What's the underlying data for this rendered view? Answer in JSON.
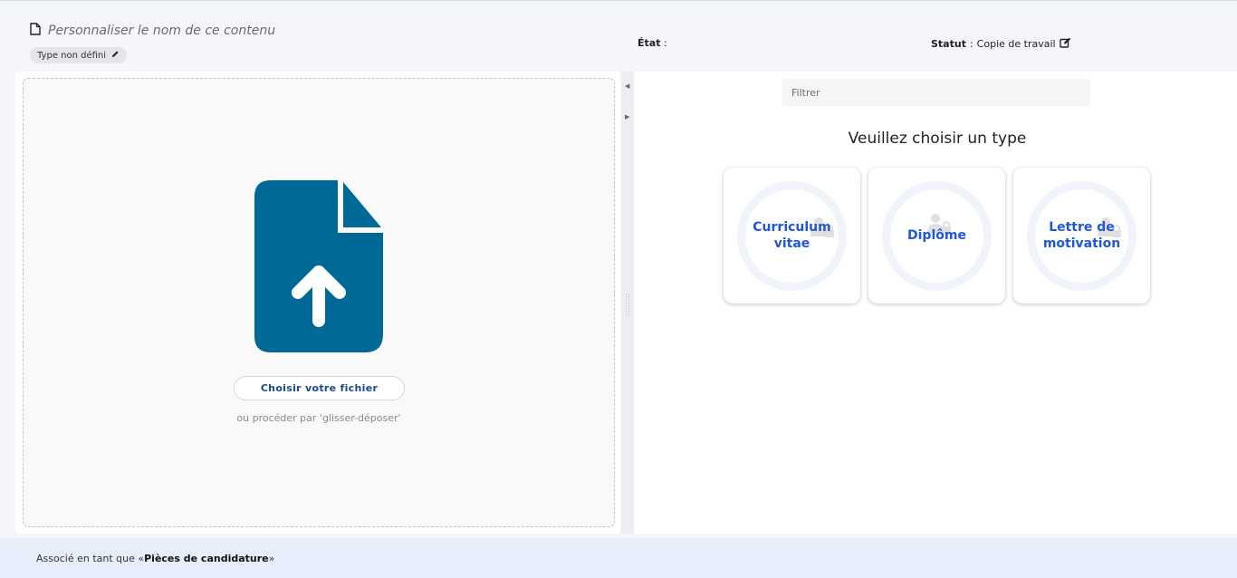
{
  "header": {
    "title_placeholder": "Personnaliser le nom de ce contenu",
    "type_badge": "Type non défini",
    "etat_label": "État",
    "etat_sep": " :",
    "statut_label": "Statut",
    "statut_sep": " : ",
    "statut_value": "Copie de travail"
  },
  "upload": {
    "choose_button": "Choisir votre fichier",
    "drag_hint": "ou procéder par 'glisser-déposer'",
    "icon": "file-upload-icon",
    "icon_color": "#006a96"
  },
  "picker": {
    "filter_placeholder": "Filtrer",
    "title": "Veuillez choisir un type",
    "types": [
      {
        "label": "Curriculum vitae"
      },
      {
        "label": "Diplôme"
      },
      {
        "label": "Lettre de motivation"
      }
    ],
    "accent_color": "#2057d8"
  },
  "footer": {
    "prefix": "Associé en tant que « ",
    "group": "Pièces de candidature",
    "suffix": " »"
  }
}
